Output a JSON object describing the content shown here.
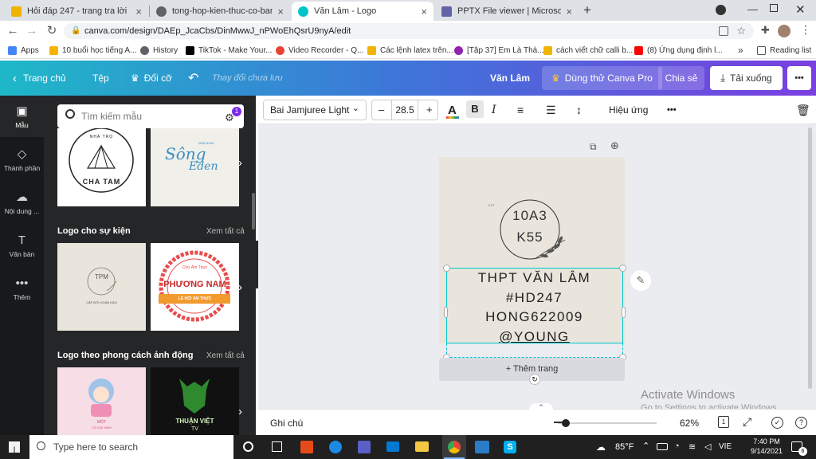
{
  "browser": {
    "tabs": [
      {
        "title": "Hỏi đáp 247 - trang tra lời",
        "favicon_color": "#f0b400"
      },
      {
        "title": "tong-hop-kien-thuc-co-ban-mo",
        "favicon_color": "#5f6368"
      },
      {
        "title": "Văn Lâm - Logo",
        "favicon_color": "#00c4cc"
      },
      {
        "title": "PPTX File viewer | Microsoft Team",
        "favicon_color": "#6264a7"
      }
    ],
    "new_tab": "+",
    "close_glyph": "×",
    "url": "canva.com/design/DAEp_JcaCbs/DinMwwJ_nPWoEhQsrU9nyA/edit",
    "bookmarks": [
      {
        "label": "Apps",
        "color": "#4285f4"
      },
      {
        "label": "10 buổi học tiếng A...",
        "color": "#f4b400"
      },
      {
        "label": "History",
        "color": "#5f6368"
      },
      {
        "label": "TikTok - Make Your...",
        "color": "#000000"
      },
      {
        "label": "Video Recorder - Q...",
        "color": "#ea4335"
      },
      {
        "label": "Các lệnh latex trên...",
        "color": "#f0b400"
      },
      {
        "label": "[Tập 37] Em Là Thà...",
        "color": "#8e24aa"
      },
      {
        "label": "cách viết chữ calli b...",
        "color": "#f0b400"
      },
      {
        "label": "(8) Ứng dụng định l...",
        "color": "#ff0000"
      }
    ],
    "reading_list": "Reading list",
    "more_bookmarks": "»"
  },
  "canva": {
    "header": {
      "home": "Trang chủ",
      "file": "Tệp",
      "resize": "Đổi cỡ",
      "undo_status": "Thay đổi chưa lưu",
      "title": "Văn Lâm",
      "try_pro": "Dùng thử Canva Pro",
      "share": "Chia sẻ",
      "download": "Tải xuống",
      "more": "•••"
    },
    "rail": [
      {
        "label": "Mẫu",
        "icon": "template-icon"
      },
      {
        "label": "Thành phần",
        "icon": "elements-icon"
      },
      {
        "label": "Nội dung ...",
        "icon": "upload-icon"
      },
      {
        "label": "Văn bản",
        "icon": "text-icon"
      },
      {
        "label": "Thêm",
        "icon": "more-icon"
      }
    ],
    "search": {
      "placeholder": "Tìm kiếm mẫu",
      "badge": "1"
    },
    "sections": [
      {
        "title": "Logo cho sự kiện",
        "see_all": "Xem tất cả"
      },
      {
        "title": "Logo theo phong cách ảnh động",
        "see_all": "Xem tất cả"
      }
    ],
    "thumbs": {
      "chatam": {
        "top": "NHÀ TRỌ",
        "bottom": "CHA TAM"
      },
      "song": {
        "title": "Sông",
        "sub": "Eden",
        "small": "NHÀ NGHỈ"
      },
      "tpm": {
        "mono": "TPM",
        "sub": "CẶP ĐÔI HOÀN HẢO"
      },
      "phuongnam": {
        "top": "Chợ Ẩm Thực",
        "name": "PHƯƠNG NAM",
        "ribbon": "LỄ HỘI ẨM THỰC"
      },
      "cute": {
        "name": "MỘT",
        "sub": "CÔ GÁI XINH"
      },
      "wolf": {
        "name": "THUẬN VIỆT",
        "sub": "TV"
      }
    },
    "toolbar": {
      "font": "Bai Jamjuree Light",
      "minus": "–",
      "size": "28.5",
      "plus": "+",
      "color_letter": "A",
      "bold": "B",
      "italic": "I",
      "effects": "Hiệu ứng",
      "more": "•••"
    },
    "design": {
      "circle_line1": "10A3",
      "circle_line2": "K55",
      "tiny": "EST",
      "lines": [
        "THPT VĂN LÂM",
        "#HD247",
        "HONG622009",
        "@YOUNG"
      ]
    },
    "add_page": "+ Thêm trang",
    "footer": {
      "notes": "Ghi chú",
      "zoom": "62%",
      "page_num": "1"
    },
    "watermark": {
      "title": "Activate Windows",
      "sub": "Go to Settings to activate Windows."
    }
  },
  "taskbar": {
    "search": "Type here to search",
    "temp": "85°F",
    "lang": "VIE",
    "time": "7:40 PM",
    "date": "9/14/2021",
    "notif": "6"
  }
}
